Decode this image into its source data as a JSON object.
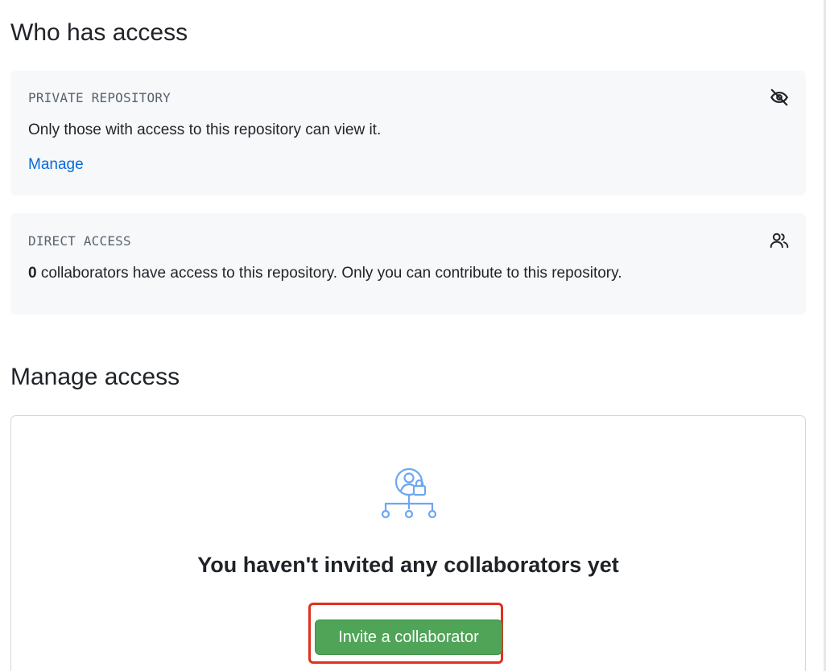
{
  "who_has_access": {
    "title": "Who has access",
    "private_card": {
      "heading": "PRIVATE REPOSITORY",
      "text": "Only those with access to this repository can view it.",
      "link": "Manage",
      "icon": "eye-closed-icon"
    },
    "direct_card": {
      "heading": "DIRECT ACCESS",
      "count": "0",
      "text": " collaborators have access to this repository. Only you can contribute to this repository.",
      "icon": "people-icon"
    }
  },
  "manage_access": {
    "title": "Manage access",
    "empty_state": {
      "icon": "collaborators-illustration-icon",
      "title": "You haven't invited any collaborators yet",
      "button_label": "Invite a collaborator"
    }
  },
  "colors": {
    "link": "#0969da",
    "button": "#4fa458",
    "highlight": "#e0301e",
    "illustration": "#6ea6f3"
  }
}
